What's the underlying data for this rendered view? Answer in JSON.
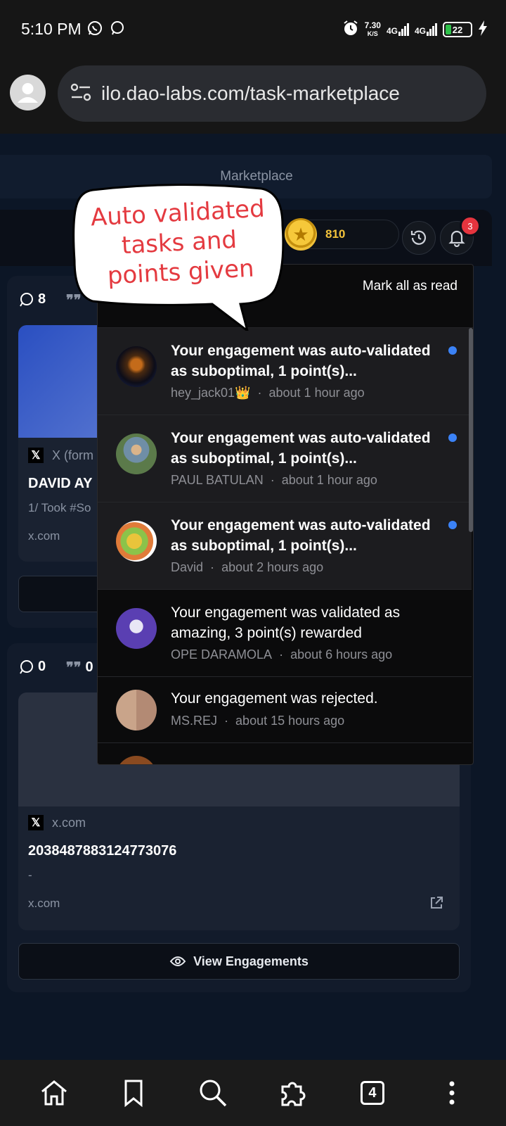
{
  "status_bar": {
    "time": "5:10 PM",
    "net_speed_value": "7.30",
    "net_speed_unit": "K/S",
    "signal_1": "4G",
    "signal_2": "4G",
    "battery": "22"
  },
  "browser": {
    "url": "ilo.dao-labs.com/task-marketplace",
    "tab_count": "4"
  },
  "page": {
    "tab_title": "Marketplace",
    "points": "810",
    "notification_badge": "3"
  },
  "annotation": {
    "line1": "Auto validated",
    "line2": "tasks and",
    "line3": "points given"
  },
  "notifications": {
    "mark_all_label": "Mark all as read",
    "items": [
      {
        "message": "Your engagement was auto-validated as suboptimal, 1 point(s)...",
        "user": "hey_jack01👑",
        "separator": "·",
        "time": "about 1 hour ago",
        "unread": true
      },
      {
        "message": "Your engagement was auto-validated as suboptimal, 1 point(s)...",
        "user": "PAUL BATULAN",
        "separator": "·",
        "time": "about 1 hour ago",
        "unread": true
      },
      {
        "message": "Your engagement was auto-validated as suboptimal, 1 point(s)...",
        "user": "David",
        "separator": "·",
        "time": "about 2 hours ago",
        "unread": true
      },
      {
        "message": "Your engagement was validated as amazing, 3 point(s) rewarded",
        "user": "OPE DARAMOLA",
        "separator": "·",
        "time": "about 6 hours ago",
        "unread": false
      },
      {
        "message": "Your engagement was rejected.",
        "user": "MS.REJ",
        "separator": "·",
        "time": "about 15 hours ago",
        "unread": false
      }
    ]
  },
  "task_cards": [
    {
      "comments": "8",
      "quotes": "",
      "source": "X (form",
      "title": "DAVID AY",
      "body": "1/ Took #So",
      "domain": "x.com"
    },
    {
      "comments": "0",
      "quotes": "0",
      "source": "x.com",
      "title": "2038487883124773076",
      "body": "-",
      "domain": "x.com",
      "button": "View Engagements"
    }
  ]
}
